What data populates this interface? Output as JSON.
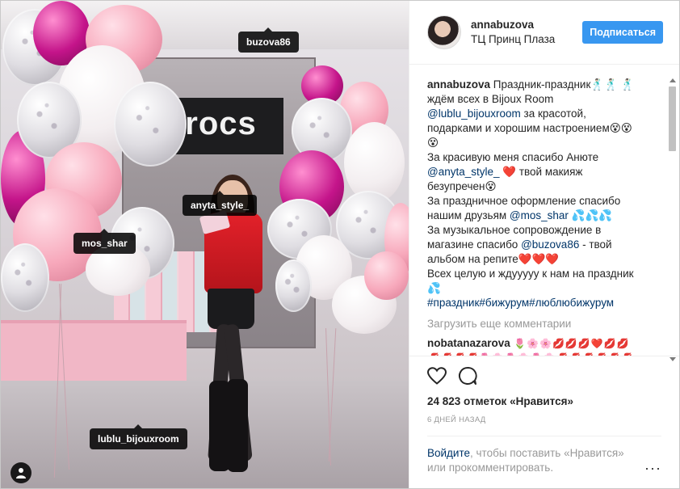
{
  "photo": {
    "store_sign": "crocs",
    "tags": {
      "buzova86": "buzova86",
      "anyta_style": "anyta_style_",
      "mos_shar": "mos_shar",
      "lublu_bijouxroom": "lublu_bijouxroom"
    },
    "user_tag_icon": "person-icon"
  },
  "header": {
    "username": "annabuzova",
    "location": "ТЦ Принц Плаза",
    "follow_label": "Подписаться"
  },
  "caption": {
    "author": "annabuzova",
    "line1": " Праздник-праздник🕺🏻🕺🏻",
    "line2": "🕺🏻 ждём всех в Bijoux Room",
    "mention1": "@lublu_bijouxroom",
    "line3": " за красотой, подарками и хорошим настроением😵😵😵",
    "line4": "За красивую меня спасибо Анюте ",
    "mention2": "@anyta_style_",
    "line5": " ❤️ твой макияж безупречен😵",
    "line6": "За праздничное оформление спасибо нашим друзьям ",
    "mention3": "@mos_shar",
    "line7": " 💦💦💦",
    "line8": "За музыкальное сопровождение в магазине спасибо ",
    "mention4": "@buzova86",
    "line9": " - твой альбом на репите❤️❤️❤️",
    "line10": "Всех целую и ждууууу к нам на праздник💦",
    "hashtags": "#праздник#бижурум#люблюбижурум"
  },
  "load_more": "Загрузить еще комментарии",
  "comment2": {
    "author": "nobatanazarova",
    "text": " 🌷🌸🌸💋💋💋❤️💋💋💋💋💋💋🌷🌸🌷🌸🌷🌸💋💋💋💋💋💋💋"
  },
  "actions": {
    "like_icon": "heart-icon",
    "comment_icon": "comment-icon",
    "likes_text": "24 823 отметок «Нравится»",
    "date_text": "6 ДНЕЙ НАЗАД"
  },
  "login": {
    "link": "Войдите",
    "text": ", чтобы поставить «Нравится» или прокомментировать."
  },
  "more_label": "···"
}
